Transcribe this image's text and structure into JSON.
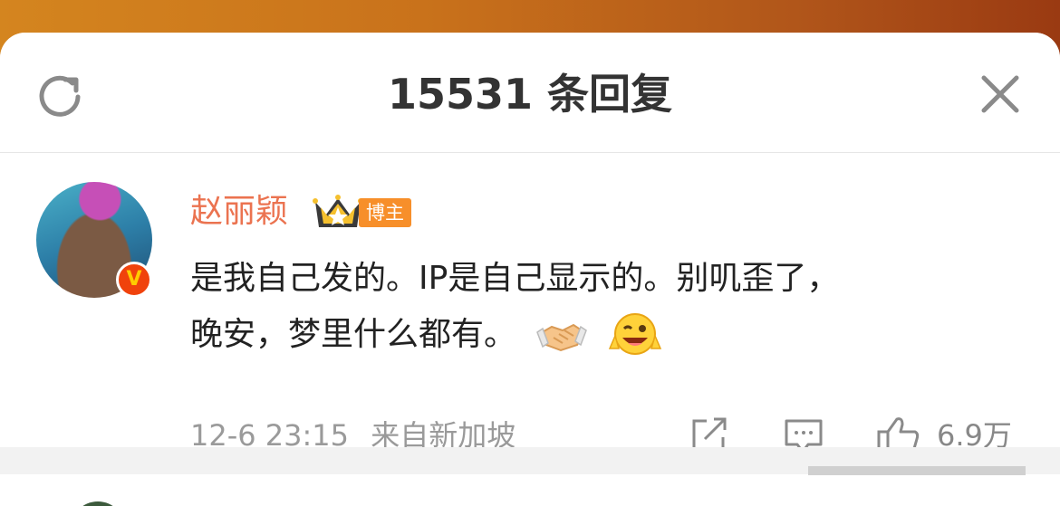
{
  "header": {
    "title": "15531 条回复",
    "refresh_icon": "refresh-icon",
    "close_icon": "close-icon"
  },
  "comment": {
    "username": "赵丽颖",
    "role_badge": "博主",
    "verified_icon": "verified-v-icon",
    "content_line1": "是我自己发的。IP是自己显示的。别叽歪了，",
    "content_line2": "晚安，梦里什么都有。",
    "emojis": [
      "handshake-emoji",
      "wink-grin-emoji"
    ],
    "time": "12-6 23:15",
    "source": "来自新加坡",
    "like_count": "6.9万"
  },
  "colors": {
    "accent_orange": "#eb7350",
    "badge_orange": "#f78f2a",
    "verified_red": "#f0420c",
    "text": "#222222",
    "meta_gray": "#9a9a9a"
  }
}
